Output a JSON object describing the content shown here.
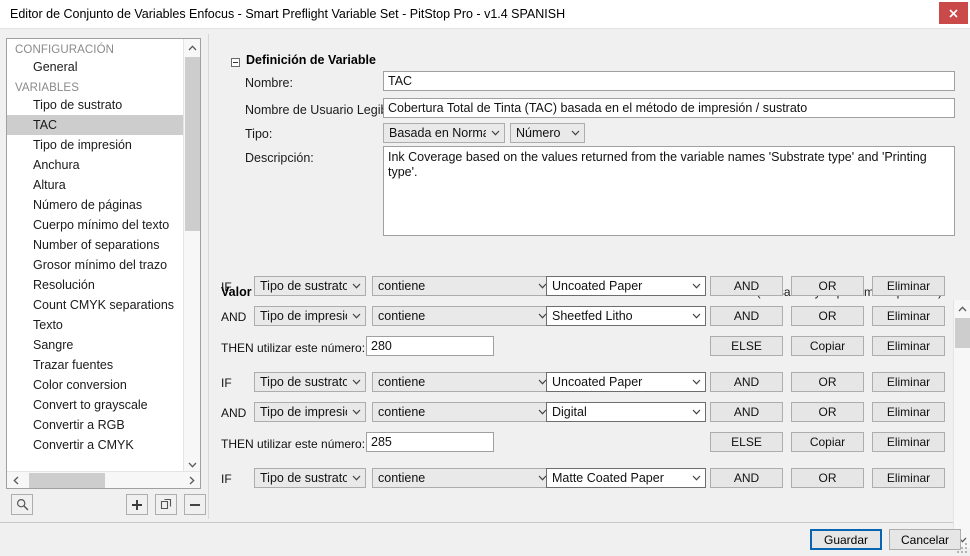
{
  "window": {
    "title": "Editor de Conjunto de Variables Enfocus - Smart Preflight Variable Set - PitStop Pro - v1.4 SPANISH",
    "close_label": "x"
  },
  "sidebar": {
    "groups": [
      {
        "label": "CONFIGURACIÓN",
        "items": [
          {
            "label": "General",
            "selected": false
          }
        ]
      },
      {
        "label": "VARIABLES",
        "items": [
          {
            "label": "Tipo de sustrato",
            "selected": false
          },
          {
            "label": "TAC",
            "selected": true
          },
          {
            "label": "Tipo de impresión",
            "selected": false
          },
          {
            "label": "Anchura",
            "selected": false
          },
          {
            "label": "Altura",
            "selected": false
          },
          {
            "label": "Número de páginas",
            "selected": false
          },
          {
            "label": "Cuerpo mínimo del texto",
            "selected": false
          },
          {
            "label": "Number of separations",
            "selected": false
          },
          {
            "label": "Grosor mínimo del trazo",
            "selected": false
          },
          {
            "label": "Resolución",
            "selected": false
          },
          {
            "label": "Count CMYK separations",
            "selected": false
          },
          {
            "label": "Texto",
            "selected": false
          },
          {
            "label": "Sangre",
            "selected": false
          },
          {
            "label": "Trazar fuentes",
            "selected": false
          },
          {
            "label": "Color conversion",
            "selected": false
          },
          {
            "label": "Convert to grayscale",
            "selected": false
          },
          {
            "label": "Convertir a RGB",
            "selected": false
          },
          {
            "label": "Convertir a CMYK",
            "selected": false
          }
        ]
      }
    ],
    "toolbar": {
      "search_title": "Buscar",
      "add_title": "+",
      "duplicate_title": "Duplicar",
      "remove_title": "−"
    }
  },
  "definition": {
    "section_title": "Definición de Variable",
    "name_label": "Nombre:",
    "name_value": "TAC",
    "readable_label": "Nombre de Usuario Legible:",
    "readable_value": "Cobertura Total de Tinta (TAC) basada en el método de impresión / sustrato",
    "type_label": "Tipo:",
    "type_value": "Basada en Norma",
    "datatype_value": "Número",
    "description_label": "Descripción:",
    "description_value": "Ink Coverage based on the values returned from the variable names 'Substrate type' and 'Printing type'."
  },
  "variable_value": {
    "section_title": "Valor de Variable",
    "hint": "(Pulsar Mayús para más opciones)",
    "rows": [
      {
        "prefix": "IF",
        "field": "Tipo de sustrato",
        "operator": "contiene",
        "value": "Uncoated Paper",
        "buttons": [
          "AND",
          "OR",
          "Eliminar"
        ]
      },
      {
        "prefix": "AND",
        "field": "Tipo de impresión",
        "operator": "contiene",
        "value": "Sheetfed Litho",
        "buttons": [
          "AND",
          "OR",
          "Eliminar"
        ]
      },
      {
        "then_label": "THEN utilizar este número:",
        "then_value": "280",
        "buttons": [
          "ELSE",
          "Copiar",
          "Eliminar"
        ]
      },
      {
        "prefix": "IF",
        "field": "Tipo de sustrato",
        "operator": "contiene",
        "value": "Uncoated Paper",
        "buttons": [
          "AND",
          "OR",
          "Eliminar"
        ]
      },
      {
        "prefix": "AND",
        "field": "Tipo de impresión",
        "operator": "contiene",
        "value": "Digital",
        "buttons": [
          "AND",
          "OR",
          "Eliminar"
        ]
      },
      {
        "then_label": "THEN utilizar este número:",
        "then_value": "285",
        "buttons": [
          "ELSE",
          "Copiar",
          "Eliminar"
        ]
      },
      {
        "prefix": "IF",
        "field": "Tipo de sustrato",
        "operator": "contiene",
        "value": "Matte Coated Paper",
        "buttons": [
          "AND",
          "OR",
          "Eliminar"
        ]
      }
    ]
  },
  "footer": {
    "save_label": "Guardar",
    "cancel_label": "Cancelar"
  },
  "colors": {
    "close_red": "#ca4a4a",
    "focus_blue": "#0a64b4",
    "selection_grey": "#cdcdcd"
  }
}
